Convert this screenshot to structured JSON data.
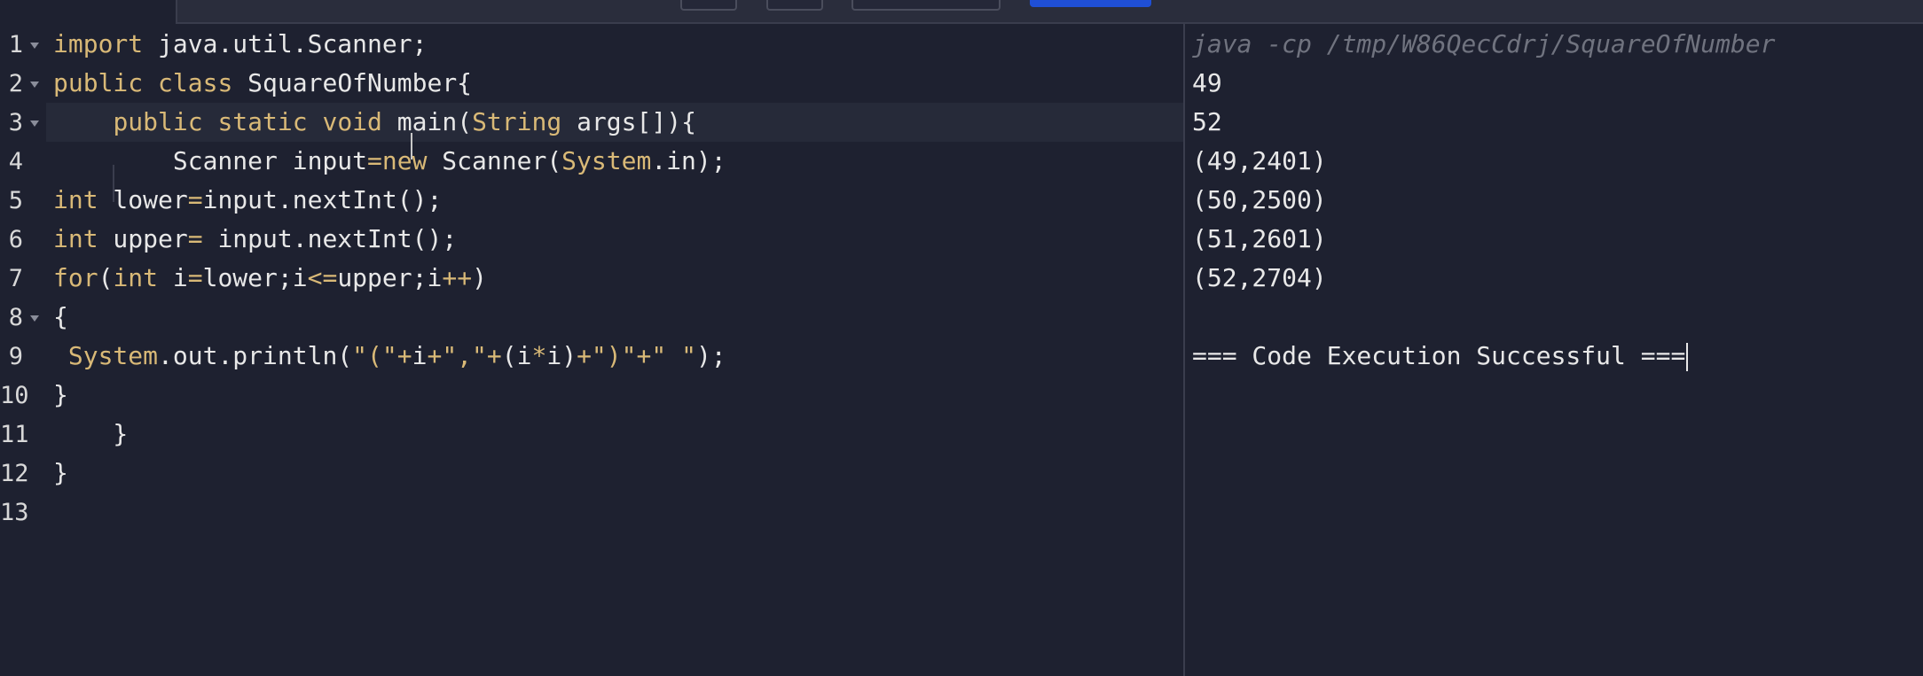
{
  "editor": {
    "lines": [
      {
        "num": "1",
        "fold": true,
        "tokens": [
          [
            "kw",
            "import"
          ],
          [
            "id",
            " java.util.Scanner;"
          ]
        ]
      },
      {
        "num": "2",
        "fold": true,
        "tokens": [
          [
            "kw",
            "public"
          ],
          [
            "id",
            " "
          ],
          [
            "kw",
            "class"
          ],
          [
            "id",
            " SquareOfNumber{"
          ]
        ]
      },
      {
        "num": "3",
        "fold": true,
        "tokens": [
          [
            "id",
            "    "
          ],
          [
            "kw",
            "public"
          ],
          [
            "id",
            " "
          ],
          [
            "kw",
            "static"
          ],
          [
            "id",
            " "
          ],
          [
            "kw",
            "void"
          ],
          [
            "id",
            " main("
          ],
          [
            "ty",
            "String"
          ],
          [
            "id",
            " args[]){"
          ]
        ]
      },
      {
        "num": "4",
        "fold": false,
        "tokens": [
          [
            "id",
            "        Scanner input"
          ],
          [
            "op",
            "="
          ],
          [
            "kw",
            "new"
          ],
          [
            "id",
            " Scanner("
          ],
          [
            "ty",
            "System"
          ],
          [
            "id",
            ".in);"
          ]
        ]
      },
      {
        "num": "5",
        "fold": false,
        "tokens": [
          [
            "kw",
            "int"
          ],
          [
            "id",
            " lower"
          ],
          [
            "op",
            "="
          ],
          [
            "id",
            "input.nextInt();"
          ]
        ]
      },
      {
        "num": "6",
        "fold": false,
        "tokens": [
          [
            "kw",
            "int"
          ],
          [
            "id",
            " upper"
          ],
          [
            "op",
            "="
          ],
          [
            "id",
            " input.nextInt();"
          ]
        ]
      },
      {
        "num": "7",
        "fold": false,
        "tokens": [
          [
            "kw",
            "for"
          ],
          [
            "id",
            "("
          ],
          [
            "kw",
            "int"
          ],
          [
            "id",
            " i"
          ],
          [
            "op",
            "="
          ],
          [
            "id",
            "lower;i"
          ],
          [
            "op",
            "<="
          ],
          [
            "id",
            "upper;i"
          ],
          [
            "op",
            "++"
          ],
          [
            "id",
            ")"
          ]
        ]
      },
      {
        "num": "8",
        "fold": true,
        "tokens": [
          [
            "id",
            "{"
          ]
        ]
      },
      {
        "num": "9",
        "fold": false,
        "tokens": [
          [
            "id",
            " "
          ],
          [
            "ty",
            "System"
          ],
          [
            "id",
            ".out.println("
          ],
          [
            "str",
            "\"(\""
          ],
          [
            "op",
            "+"
          ],
          [
            "id",
            "i"
          ],
          [
            "op",
            "+"
          ],
          [
            "str",
            "\",\""
          ],
          [
            "op",
            "+"
          ],
          [
            "id",
            "(i"
          ],
          [
            "op",
            "*"
          ],
          [
            "id",
            "i)"
          ],
          [
            "op",
            "+"
          ],
          [
            "str",
            "\")\""
          ],
          [
            "op",
            "+"
          ],
          [
            "str",
            "\" \""
          ],
          [
            "id",
            ");"
          ]
        ]
      },
      {
        "num": "10",
        "fold": false,
        "tokens": [
          [
            "id",
            "}"
          ]
        ]
      },
      {
        "num": "11",
        "fold": false,
        "tokens": [
          [
            "id",
            "    }"
          ]
        ]
      },
      {
        "num": "12",
        "fold": false,
        "tokens": [
          [
            "id",
            "}"
          ]
        ]
      },
      {
        "num": "13",
        "fold": false,
        "tokens": []
      }
    ]
  },
  "output": {
    "command": "java -cp /tmp/W86QecCdrj/SquareOfNumber",
    "lines": [
      "49",
      "52",
      "(49,2401)",
      "(50,2500)",
      "(51,2601)",
      "(52,2704)",
      "",
      "=== Code Execution Successful ==="
    ]
  },
  "colors": {
    "background": "#1e2130",
    "keyword": "#d9b977",
    "text": "#e8e8e8",
    "run_button": "#1f4fd6"
  }
}
